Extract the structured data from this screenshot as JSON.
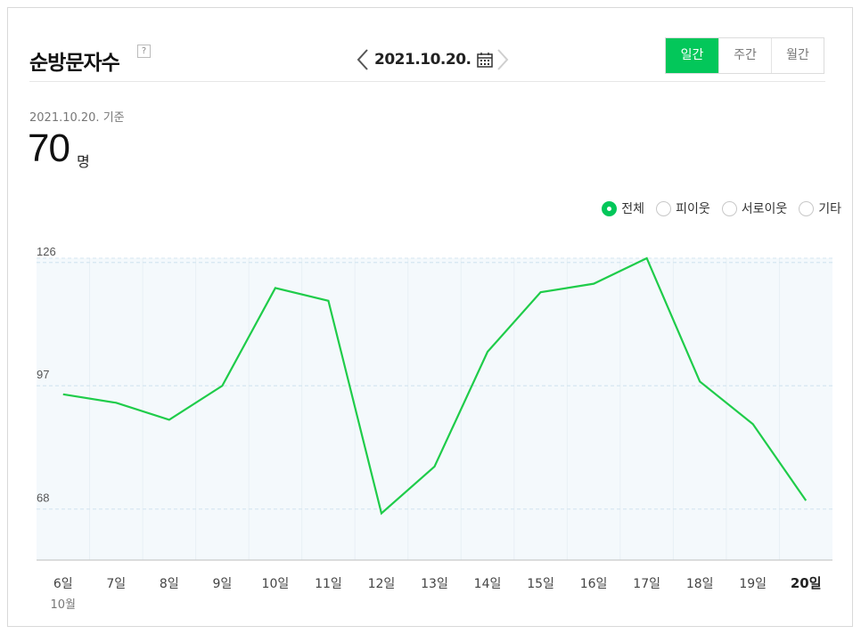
{
  "header": {
    "title": "순방문자수",
    "help_icon": "?",
    "date": "2021.10.20.",
    "prev_icon": "chevron-left-icon",
    "next_icon": "chevron-right-icon",
    "calendar_icon": "calendar-icon",
    "tabs": [
      {
        "label": "일간",
        "active": true
      },
      {
        "label": "주간",
        "active": false
      },
      {
        "label": "월간",
        "active": false
      }
    ]
  },
  "summary": {
    "basis_date": "2021.10.20. 기준",
    "value": "70",
    "unit": "명"
  },
  "filters": [
    {
      "label": "전체",
      "checked": true
    },
    {
      "label": "피이웃",
      "checked": false
    },
    {
      "label": "서로이웃",
      "checked": false
    },
    {
      "label": "기타",
      "checked": false
    }
  ],
  "colors": {
    "accent": "#03c75a",
    "line": "#1fcc4a",
    "plot_bg": "#f4f9fc",
    "grid": "#d5e6f0"
  },
  "chart_data": {
    "type": "line",
    "categories": [
      "6일",
      "7일",
      "8일",
      "9일",
      "10일",
      "11일",
      "12일",
      "13일",
      "14일",
      "15일",
      "16일",
      "17일",
      "18일",
      "19일",
      "20일"
    ],
    "month_label": "10월",
    "highlight_category": "20일",
    "values": [
      95,
      93,
      89,
      97,
      120,
      117,
      67,
      78,
      105,
      119,
      121,
      127,
      98,
      88,
      70
    ],
    "yticks": [
      126,
      97,
      68
    ],
    "ylim": [
      56,
      127
    ],
    "grid": true
  }
}
